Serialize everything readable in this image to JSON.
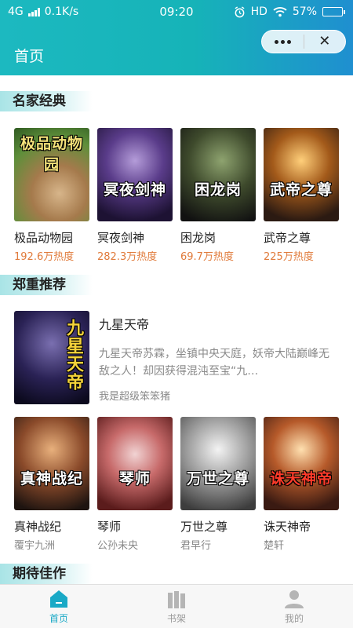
{
  "status_bar": {
    "network": "4G",
    "speed": "0.1K/s",
    "time": "09:20",
    "hd": "HD",
    "battery": "57%",
    "battery_level": 0.57
  },
  "nav": {
    "title": "首页"
  },
  "sections": {
    "classic": {
      "title": "名家经典",
      "books": [
        {
          "cover": "极品动物园",
          "name": "极品动物园",
          "heat": "192.6万热度"
        },
        {
          "cover": "冥夜剑神",
          "name": "冥夜剑神",
          "heat": "282.3万热度"
        },
        {
          "cover": "困龙岗",
          "name": "困龙岗",
          "heat": "69.7万热度"
        },
        {
          "cover": "武帝之尊",
          "name": "武帝之尊",
          "heat": "225万热度"
        }
      ]
    },
    "recommend": {
      "title": "郑重推荐",
      "featured": {
        "cover": "九星天帝",
        "title": "九星天帝",
        "desc": "九星天帝苏霖，坐镇中央天庭，妖帝大陆巅峰无敌之人！却因获得混沌至宝“九…",
        "author": "我是超级笨笨猪"
      },
      "books": [
        {
          "cover": "真神战纪",
          "name": "真神战纪",
          "author": "覆宇九洲"
        },
        {
          "cover": "琴师",
          "name": "琴师",
          "author": "公孙未央"
        },
        {
          "cover": "万世之尊",
          "name": "万世之尊",
          "author": "君早行"
        },
        {
          "cover": "诛天神帝",
          "name": "诛天神帝",
          "author": "楚轩"
        }
      ]
    },
    "upcoming": {
      "title": "期待佳作"
    }
  },
  "tabs": [
    {
      "label": "首页",
      "icon": "home-icon",
      "active": true
    },
    {
      "label": "书架",
      "icon": "bookshelf-icon",
      "active": false
    },
    {
      "label": "我的",
      "icon": "user-icon",
      "active": false
    }
  ],
  "colors": {
    "header_start": "#1cb9c0",
    "header_end": "#1f8fd0",
    "heat": "#e07a3a",
    "tab_active": "#1aa9c6",
    "tab_inactive": "#999999"
  }
}
